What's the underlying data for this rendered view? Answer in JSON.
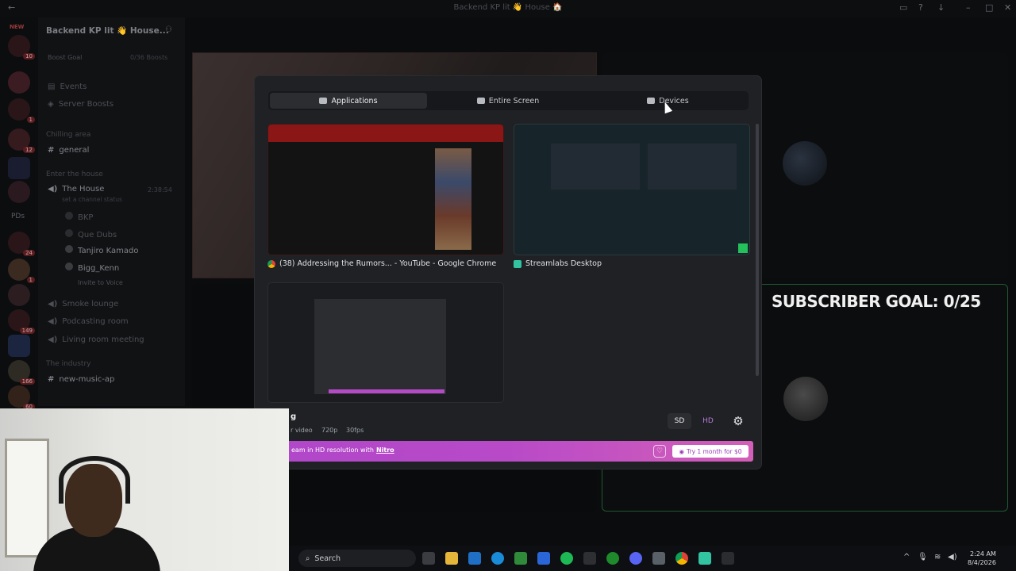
{
  "titlebar": {
    "title": "Backend KP lit 👋 House 🏠"
  },
  "rail": {
    "new_badge": "NEW",
    "badges": [
      "10",
      "1",
      "12",
      "24",
      "1",
      "149",
      "166",
      "60"
    ],
    "folder_label": "PDs"
  },
  "sidebar": {
    "server_name": "Backend KP lit 👋 House...",
    "boost_goal": "Boost Goal",
    "boost_count": "0/36 Boosts",
    "events": "Events",
    "server_boosts": "Server Boosts",
    "cat_chilling": "Chilling area",
    "general": "general",
    "cat_enter": "Enter the house",
    "the_house": "The House",
    "the_house_time": "2:38:54",
    "set_status": "set a channel status",
    "users": [
      "BKP",
      "Que Dubs",
      "Tanjiro Kamado",
      "Bigg_Kenn"
    ],
    "invite_to_voice": "Invite to Voice",
    "smoke_lounge": "Smoke lounge",
    "podcasting_room": "Podcasting room",
    "living_room": "Living room meeting",
    "cat_industry": "The industry",
    "new_music": "new-music-ap"
  },
  "stage": {
    "subscriber_goal": "SUBSCRIBER GOAL: 0/25"
  },
  "modal": {
    "tabs": [
      {
        "label": "Applications",
        "icon": "window-icon",
        "active": true
      },
      {
        "label": "Entire Screen",
        "icon": "monitor-icon",
        "active": false
      },
      {
        "label": "Devices",
        "icon": "camera-icon",
        "active": false
      }
    ],
    "sources": [
      {
        "label": "(38) Addressing the Rumors... - YouTube - Google Chrome",
        "icon": "chrome-icon"
      },
      {
        "label": "Streamlabs Desktop",
        "icon": "streamlabs-icon"
      },
      {
        "label": "",
        "icon": "discord-icon"
      }
    ],
    "settings": {
      "title_fragment": "g",
      "type_fragment": "r video",
      "resolution": "720p",
      "framerate": "30fps",
      "sd_label": "SD",
      "hd_label": "HD"
    },
    "nitro": {
      "text": "eam in HD resolution with",
      "link": "Nitro",
      "cta": "Try 1 month for $0"
    }
  },
  "taskbar": {
    "search_label": "Search",
    "time": "2:24 AM",
    "date": "8/4/2026"
  },
  "colors": {
    "accent_nitro": "#b84ac8",
    "green_border": "#1e5a32",
    "modal_bg": "#1f2124"
  }
}
